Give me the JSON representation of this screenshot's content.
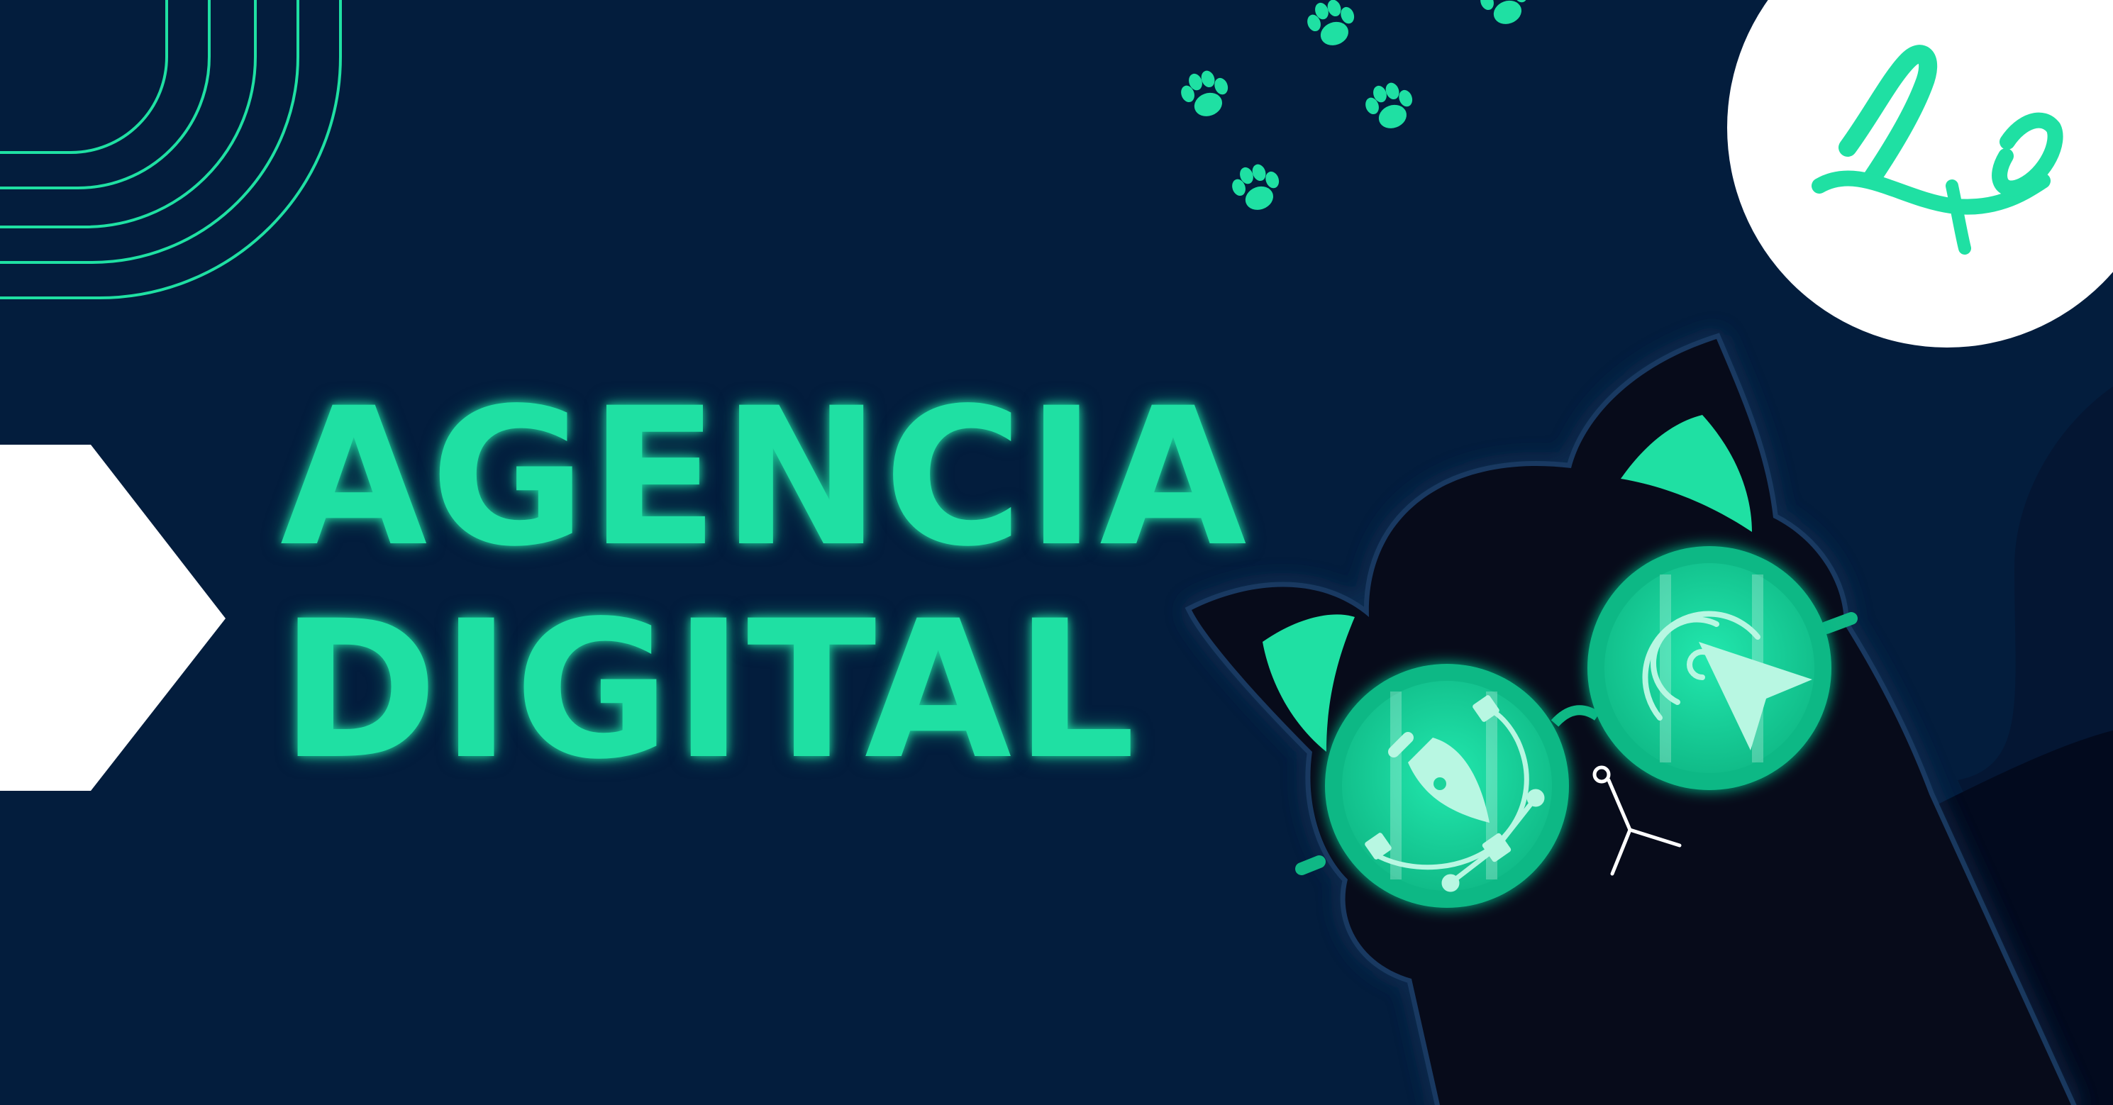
{
  "headline": {
    "line1": "AGENCIA",
    "line2": "DIGITAL"
  },
  "logo": {
    "monogram": "LQ"
  },
  "icons": [
    "corner-arcs-decoration",
    "white-arrow-shape",
    "paw-print-icon",
    "logo-badge",
    "cat-mascot",
    "pen-tool-icon",
    "cursor-click-icon",
    "crosshair-cursor-icon"
  ],
  "colors": {
    "background": "#031d3d",
    "accent": "#1fe0a3",
    "cat": "#070b1a",
    "white": "#ffffff"
  }
}
